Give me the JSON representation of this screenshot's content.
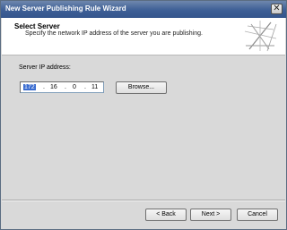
{
  "window": {
    "title": "New Server Publishing Rule Wizard",
    "close_glyph": "✕"
  },
  "header": {
    "title": "Select Server",
    "description": "Specify the network IP address of the server you are publishing."
  },
  "form": {
    "server_ip_label": "Server IP address:",
    "ip_octets": [
      "172",
      "16",
      "0",
      "11"
    ],
    "ip_separator": ".",
    "browse_label": "Browse..."
  },
  "footer": {
    "back_label": "< Back",
    "next_label": "Next >",
    "cancel_label": "Cancel"
  },
  "colors": {
    "titlebar": "#3d5f96",
    "selection": "#3a6cd0"
  },
  "icons": {
    "close": "close-icon",
    "wizard_art": "wizard-banner-icon"
  }
}
